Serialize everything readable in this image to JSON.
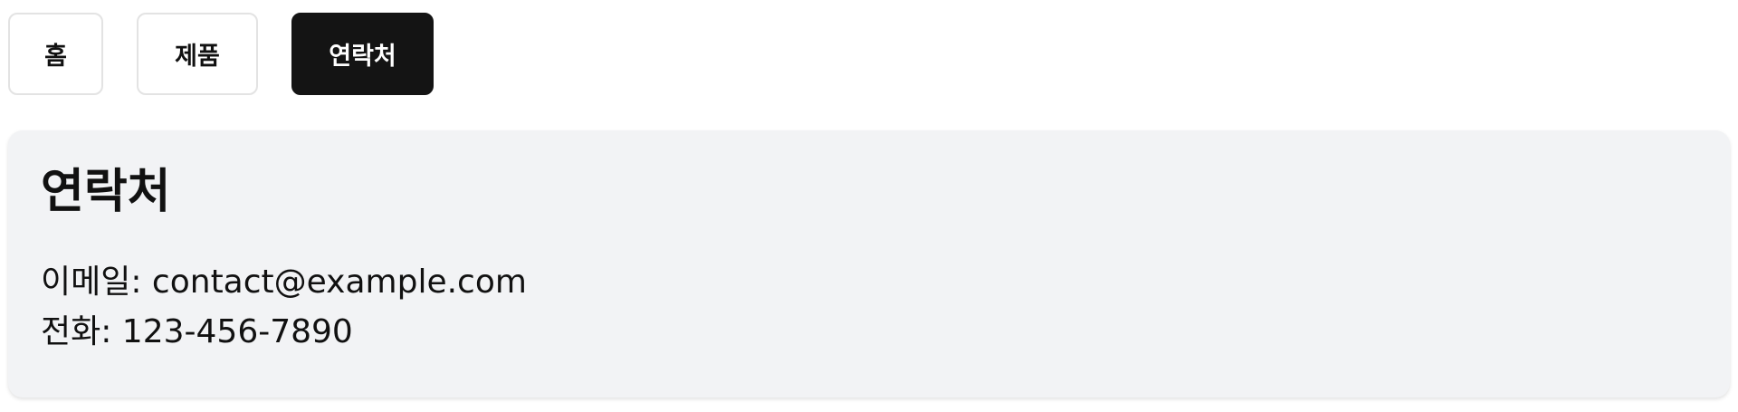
{
  "tabs": [
    {
      "label": "홈",
      "active": false
    },
    {
      "label": "제품",
      "active": false
    },
    {
      "label": "연락처",
      "active": true
    }
  ],
  "contact": {
    "title": "연락처",
    "email_line": "이메일: contact@example.com",
    "phone_line": "전화: 123-456-7890"
  },
  "colors": {
    "active_tab_bg": "#141414",
    "card_bg": "#f2f3f5",
    "tab_border": "#e3e3e3"
  }
}
